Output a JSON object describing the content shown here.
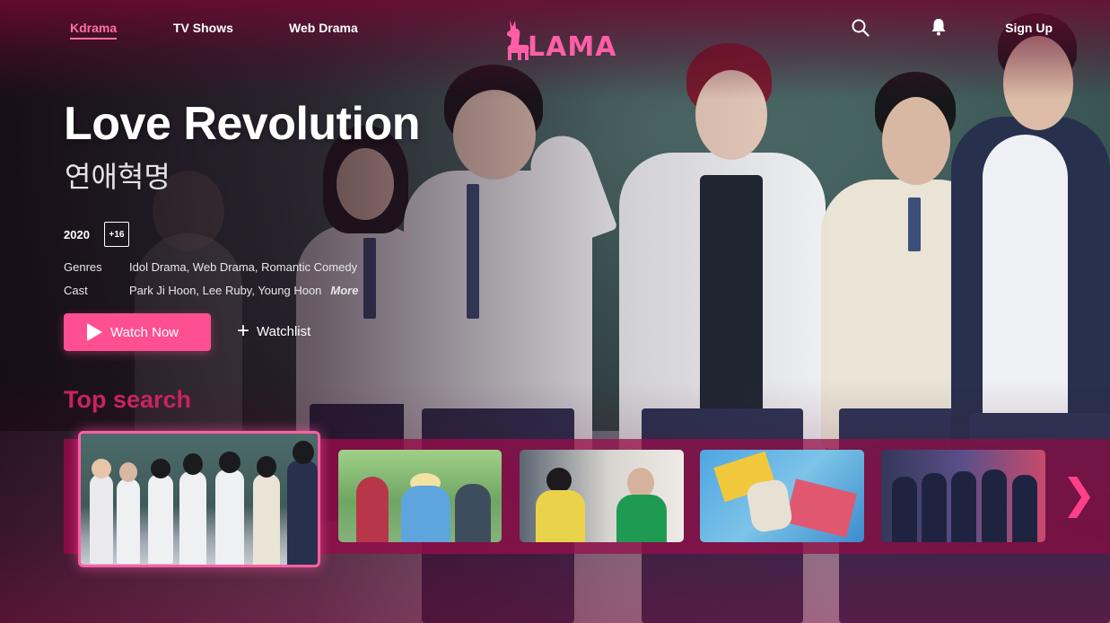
{
  "nav": {
    "links": [
      "Kdrama",
      "TV Shows",
      "Web Drama"
    ],
    "active": "Kdrama",
    "logo_text": "LAMA",
    "signup_label": "Sign Up"
  },
  "hero": {
    "title": "Love Revolution",
    "korean_title": "연애혁명",
    "year": "2020",
    "age_rating": "+16",
    "genres_label": "Genres",
    "genres": "Idol Drama, Web Drama, Romantic Comedy",
    "cast_label": "Cast",
    "cast": "Park Ji Hoon, Lee Ruby, Young Hoon",
    "more_label": "More",
    "watch_label": "Watch Now",
    "watchlist_label": "Watchlist"
  },
  "top_search": {
    "title": "Top search",
    "next_arrow": "❯"
  },
  "colors": {
    "accent": "#ff4f93",
    "section_title": "#c8245f",
    "strip": "#8c0a46"
  },
  "icons": [
    "llama-logo-icon",
    "search-icon",
    "bell-icon",
    "play-icon",
    "plus-icon",
    "chevron-right-icon"
  ]
}
